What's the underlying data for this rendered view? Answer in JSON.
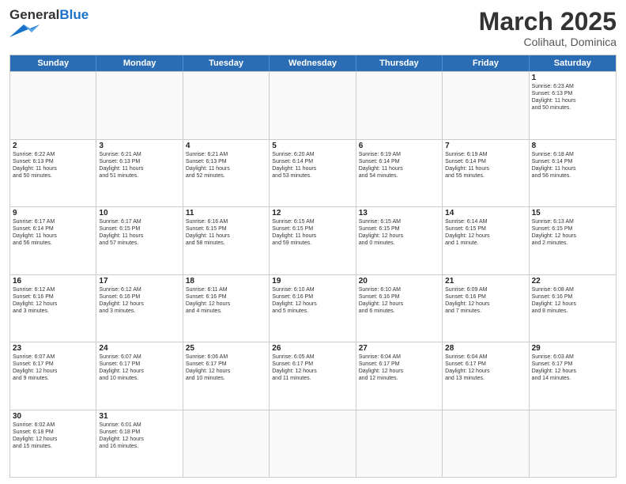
{
  "header": {
    "logo_general": "General",
    "logo_blue": "Blue",
    "month_title": "March 2025",
    "subtitle": "Colihaut, Dominica"
  },
  "weekdays": [
    "Sunday",
    "Monday",
    "Tuesday",
    "Wednesday",
    "Thursday",
    "Friday",
    "Saturday"
  ],
  "rows": [
    [
      {
        "day": "",
        "info": ""
      },
      {
        "day": "",
        "info": ""
      },
      {
        "day": "",
        "info": ""
      },
      {
        "day": "",
        "info": ""
      },
      {
        "day": "",
        "info": ""
      },
      {
        "day": "",
        "info": ""
      },
      {
        "day": "1",
        "info": "Sunrise: 6:23 AM\nSunset: 6:13 PM\nDaylight: 11 hours\nand 50 minutes."
      }
    ],
    [
      {
        "day": "2",
        "info": "Sunrise: 6:22 AM\nSunset: 6:13 PM\nDaylight: 11 hours\nand 50 minutes."
      },
      {
        "day": "3",
        "info": "Sunrise: 6:21 AM\nSunset: 6:13 PM\nDaylight: 11 hours\nand 51 minutes."
      },
      {
        "day": "4",
        "info": "Sunrise: 6:21 AM\nSunset: 6:13 PM\nDaylight: 11 hours\nand 52 minutes."
      },
      {
        "day": "5",
        "info": "Sunrise: 6:20 AM\nSunset: 6:14 PM\nDaylight: 11 hours\nand 53 minutes."
      },
      {
        "day": "6",
        "info": "Sunrise: 6:19 AM\nSunset: 6:14 PM\nDaylight: 11 hours\nand 54 minutes."
      },
      {
        "day": "7",
        "info": "Sunrise: 6:19 AM\nSunset: 6:14 PM\nDaylight: 11 hours\nand 55 minutes."
      },
      {
        "day": "8",
        "info": "Sunrise: 6:18 AM\nSunset: 6:14 PM\nDaylight: 11 hours\nand 56 minutes."
      }
    ],
    [
      {
        "day": "9",
        "info": "Sunrise: 6:17 AM\nSunset: 6:14 PM\nDaylight: 11 hours\nand 56 minutes."
      },
      {
        "day": "10",
        "info": "Sunrise: 6:17 AM\nSunset: 6:15 PM\nDaylight: 11 hours\nand 57 minutes."
      },
      {
        "day": "11",
        "info": "Sunrise: 6:16 AM\nSunset: 6:15 PM\nDaylight: 11 hours\nand 58 minutes."
      },
      {
        "day": "12",
        "info": "Sunrise: 6:15 AM\nSunset: 6:15 PM\nDaylight: 11 hours\nand 59 minutes."
      },
      {
        "day": "13",
        "info": "Sunrise: 6:15 AM\nSunset: 6:15 PM\nDaylight: 12 hours\nand 0 minutes."
      },
      {
        "day": "14",
        "info": "Sunrise: 6:14 AM\nSunset: 6:15 PM\nDaylight: 12 hours\nand 1 minute."
      },
      {
        "day": "15",
        "info": "Sunrise: 6:13 AM\nSunset: 6:15 PM\nDaylight: 12 hours\nand 2 minutes."
      }
    ],
    [
      {
        "day": "16",
        "info": "Sunrise: 6:12 AM\nSunset: 6:16 PM\nDaylight: 12 hours\nand 3 minutes."
      },
      {
        "day": "17",
        "info": "Sunrise: 6:12 AM\nSunset: 6:16 PM\nDaylight: 12 hours\nand 3 minutes."
      },
      {
        "day": "18",
        "info": "Sunrise: 6:11 AM\nSunset: 6:16 PM\nDaylight: 12 hours\nand 4 minutes."
      },
      {
        "day": "19",
        "info": "Sunrise: 6:10 AM\nSunset: 6:16 PM\nDaylight: 12 hours\nand 5 minutes."
      },
      {
        "day": "20",
        "info": "Sunrise: 6:10 AM\nSunset: 6:16 PM\nDaylight: 12 hours\nand 6 minutes."
      },
      {
        "day": "21",
        "info": "Sunrise: 6:09 AM\nSunset: 6:16 PM\nDaylight: 12 hours\nand 7 minutes."
      },
      {
        "day": "22",
        "info": "Sunrise: 6:08 AM\nSunset: 6:16 PM\nDaylight: 12 hours\nand 8 minutes."
      }
    ],
    [
      {
        "day": "23",
        "info": "Sunrise: 6:07 AM\nSunset: 6:17 PM\nDaylight: 12 hours\nand 9 minutes."
      },
      {
        "day": "24",
        "info": "Sunrise: 6:07 AM\nSunset: 6:17 PM\nDaylight: 12 hours\nand 10 minutes."
      },
      {
        "day": "25",
        "info": "Sunrise: 6:06 AM\nSunset: 6:17 PM\nDaylight: 12 hours\nand 10 minutes."
      },
      {
        "day": "26",
        "info": "Sunrise: 6:05 AM\nSunset: 6:17 PM\nDaylight: 12 hours\nand 11 minutes."
      },
      {
        "day": "27",
        "info": "Sunrise: 6:04 AM\nSunset: 6:17 PM\nDaylight: 12 hours\nand 12 minutes."
      },
      {
        "day": "28",
        "info": "Sunrise: 6:04 AM\nSunset: 6:17 PM\nDaylight: 12 hours\nand 13 minutes."
      },
      {
        "day": "29",
        "info": "Sunrise: 6:03 AM\nSunset: 6:17 PM\nDaylight: 12 hours\nand 14 minutes."
      }
    ],
    [
      {
        "day": "30",
        "info": "Sunrise: 6:02 AM\nSunset: 6:18 PM\nDaylight: 12 hours\nand 15 minutes."
      },
      {
        "day": "31",
        "info": "Sunrise: 6:01 AM\nSunset: 6:18 PM\nDaylight: 12 hours\nand 16 minutes."
      },
      {
        "day": "",
        "info": ""
      },
      {
        "day": "",
        "info": ""
      },
      {
        "day": "",
        "info": ""
      },
      {
        "day": "",
        "info": ""
      },
      {
        "day": "",
        "info": ""
      }
    ]
  ]
}
